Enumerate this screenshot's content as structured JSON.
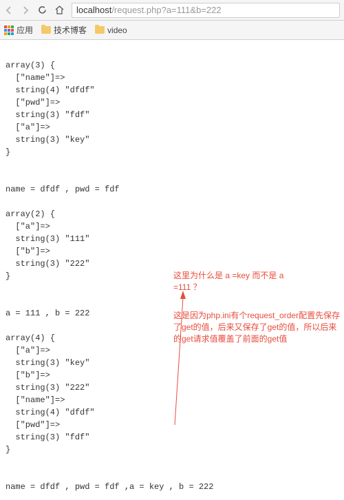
{
  "toolbar": {
    "url_host": "localhost",
    "url_path": "/request.php?a=111&b=222"
  },
  "bookmarks": {
    "apps": "应用",
    "blog": "技术博客",
    "video": "video"
  },
  "content": {
    "block1": "array(3) {\n  [\"name\"]=>\n  string(4) \"dfdf\"\n  [\"pwd\"]=>\n  string(3) \"fdf\"\n  [\"a\"]=>\n  string(3) \"key\"\n}",
    "line1": "name = dfdf , pwd = fdf",
    "block2": "array(2) {\n  [\"a\"]=>\n  string(3) \"111\"\n  [\"b\"]=>\n  string(3) \"222\"\n}",
    "line2": "a = 111 , b = 222",
    "block3": "array(4) {\n  [\"a\"]=>\n  string(3) \"key\"\n  [\"b\"]=>\n  string(3) \"222\"\n  [\"name\"]=>\n  string(4) \"dfdf\"\n  [\"pwd\"]=>\n  string(3) \"fdf\"\n}",
    "line3": "name = dfdf , pwd = fdf ,a = key , b = 222"
  },
  "annotations": {
    "q": "这里为什么是 a =key\n而不是 a =111 ？",
    "a": "这是因为php.ini有个request_order配置先保存了get的值，后来又保存了get的值，所以后来的get请求值覆盖了前面的get值"
  }
}
